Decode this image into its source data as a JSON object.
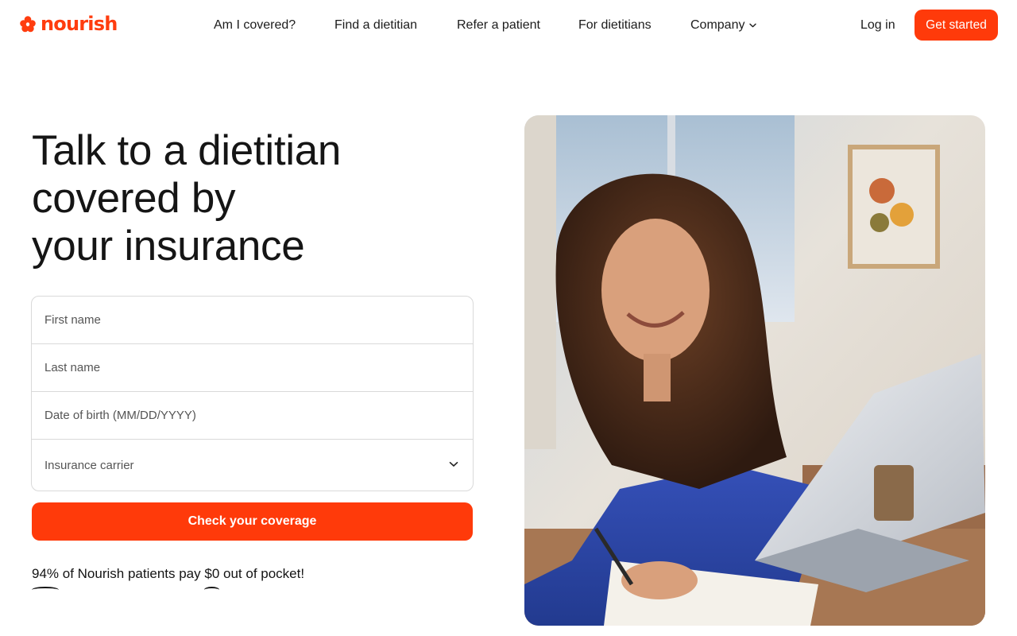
{
  "brand": {
    "name": "nourish",
    "accent_color": "#ff3a0a",
    "logo_icon": "flower-icon"
  },
  "nav": {
    "items": [
      {
        "label": "Am I covered?"
      },
      {
        "label": "Find a dietitian"
      },
      {
        "label": "Refer a patient"
      },
      {
        "label": "For dietitians"
      },
      {
        "label": "Company",
        "has_dropdown": true
      }
    ],
    "login_label": "Log in",
    "cta_label": "Get started"
  },
  "hero": {
    "title_lines": [
      "Talk to a dietitian",
      "covered by",
      "your insurance"
    ],
    "form": {
      "first_name_placeholder": "First name",
      "last_name_placeholder": "Last name",
      "dob_placeholder": "Date of birth (MM/DD/YYYY)",
      "carrier_placeholder": "Insurance carrier",
      "submit_label": "Check your coverage"
    },
    "stat": {
      "percent": "94%",
      "middle": " of Nourish patients pay ",
      "amount": "$0",
      "suffix": " out of pocket!"
    },
    "photo_alt": "woman-writing-at-laptop-photo"
  }
}
